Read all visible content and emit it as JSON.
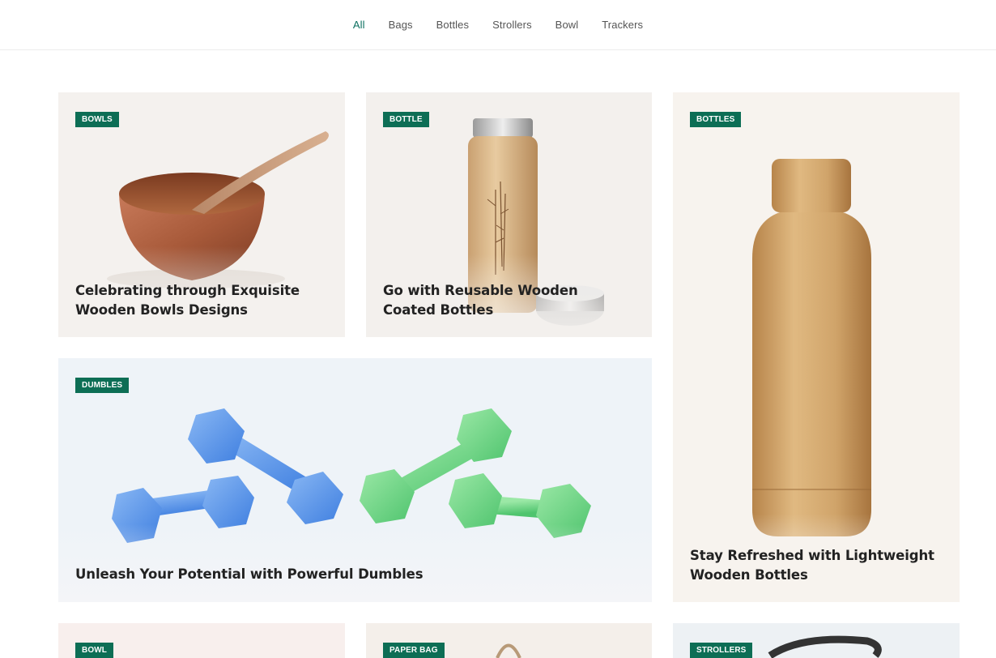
{
  "filters": [
    {
      "label": "All",
      "active": true
    },
    {
      "label": "Bags",
      "active": false
    },
    {
      "label": "Bottles",
      "active": false
    },
    {
      "label": "Strollers",
      "active": false
    },
    {
      "label": "Bowl",
      "active": false
    },
    {
      "label": "Trackers",
      "active": false
    }
  ],
  "cards": {
    "bowls": {
      "badge": "BOWLS",
      "title": "Celebrating through Exquisite Wooden Bowls Designs"
    },
    "bottle": {
      "badge": "BOTTLE",
      "title": "Go with Reusable Wooden Coated Bottles"
    },
    "bottles": {
      "badge": "BOTTLES",
      "title": "Stay Refreshed with Lightweight Wooden Bottles"
    },
    "dumbles": {
      "badge": "DUMBLES",
      "title": "Unleash Your Potential with Powerful Dumbles"
    },
    "bowl": {
      "badge": "BOWL"
    },
    "paper_bag": {
      "badge": "PAPER BAG"
    },
    "strollers": {
      "badge": "STROLLERS"
    }
  },
  "colors": {
    "accent": "#0d7060",
    "badge_bg": "#0d6e55"
  }
}
